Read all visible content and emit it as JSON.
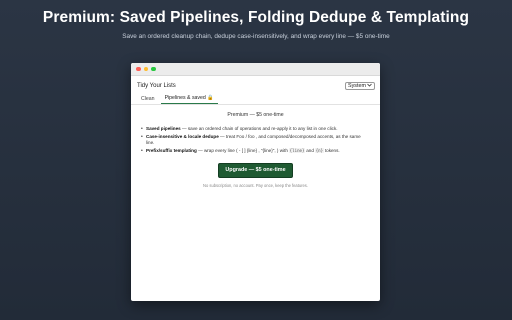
{
  "hero": {
    "title": "Premium: Saved Pipelines, Folding Dedupe & Templating",
    "subtitle": "Save an ordered cleanup chain, dedupe case-insensitively, and wrap every line — $5 one-time"
  },
  "window": {
    "app_title": "Tidy Your Lists",
    "theme_select": {
      "value": "System"
    },
    "tabs": [
      {
        "label": "Clean"
      },
      {
        "label": "Pipelines & saved 🔒"
      }
    ],
    "panel": {
      "title": "Premium — $5 one-time",
      "features": [
        {
          "name": "Saved pipelines",
          "text": " — save an ordered chain of operations and re-apply it to any list in one click."
        },
        {
          "name": "Case-insensitive & locale dedupe",
          "text": " — treat Foo / foo , and composed/decomposed accents, as the same line."
        },
        {
          "name": "Prefix/suffix templating",
          "text_before": " — wrap every line ( - [ ] {line} , \"{line}\", ) with ",
          "code1": "{line}",
          "text_mid": " and ",
          "code2": "{n}",
          "text_after": " tokens."
        }
      ],
      "buy_label": "Upgrade — $5 one-time",
      "footnote": "No subscription, no account. Pay once, keep the features."
    }
  },
  "colors": {
    "accent_green": "#1f5a32",
    "background": "#2b3544"
  }
}
